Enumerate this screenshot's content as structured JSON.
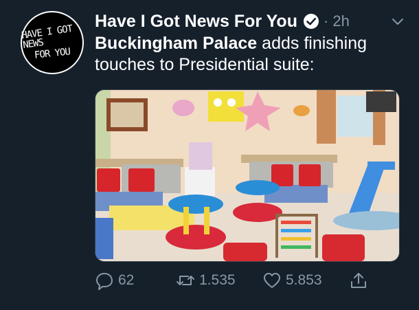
{
  "account": {
    "display_name": "Have I Got News For You",
    "avatar_text_line1": "HAVE I GOT NEWS",
    "avatar_text_line2": "FOR YOU",
    "meta": "· 2h"
  },
  "tweet": {
    "bold_text": "Buckingham Palace",
    "rest_text": " adds finishing touches to Presidential suite:"
  },
  "media": {
    "subject": "children's playroom with cartoon wall murals, red cushions, baby activity centres, abacus, blue slide"
  },
  "actions": {
    "reply_count": "62",
    "retweet_count": "1.535",
    "like_count": "5.853"
  },
  "colors": {
    "background": "#15202b",
    "muted": "#8899a6",
    "text": "#ffffff"
  }
}
